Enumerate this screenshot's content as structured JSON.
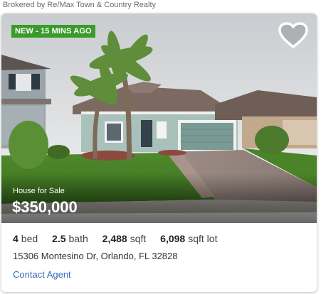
{
  "broker_text": "Brokered by Re/Max Town & Country Realty",
  "badge": "NEW - 15 MINS AGO",
  "status": "House for Sale",
  "price": "$350,000",
  "facts": [
    {
      "value": "4",
      "unit": "bed"
    },
    {
      "value": "2.5",
      "unit": "bath"
    },
    {
      "value": "2,488",
      "unit": "sqft"
    },
    {
      "value": "6,098",
      "unit": "sqft lot"
    }
  ],
  "address": "15306 Montesino Dr, Orlando, FL 32828",
  "contact_label": "Contact Agent",
  "colors": {
    "badge": "#3a9b2b",
    "link": "#2e6fb8"
  },
  "icons": {
    "favorite": "heart-outline-icon"
  }
}
